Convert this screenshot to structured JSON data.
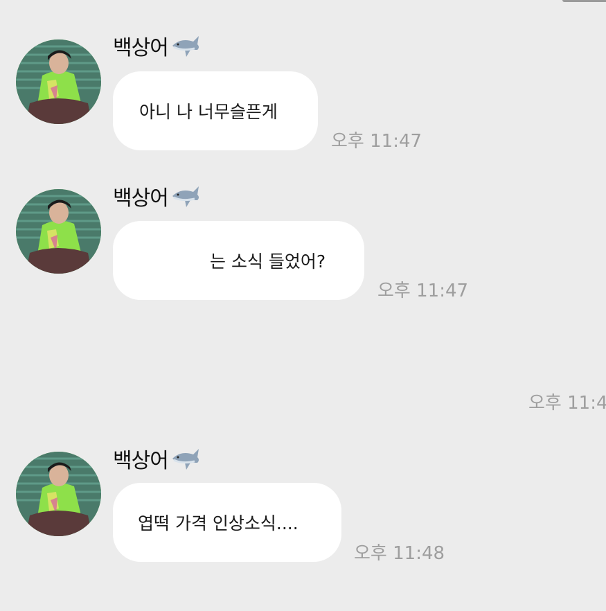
{
  "chat": {
    "messages": [
      {
        "sender": "백상어",
        "text": "아니 나 너무슬픈게",
        "time": "오후 11:47"
      },
      {
        "sender": "백상어",
        "text": "는 소식 들었어?",
        "time": "오후 11:47"
      },
      {
        "sender": "백상어",
        "text": "엽떡 가격 인상소식....",
        "time": "오후 11:48"
      }
    ],
    "cut_off_time": "오후 11:4"
  },
  "icons": {
    "sender_emoji": "shark-icon",
    "avatar": "profile-photo"
  }
}
